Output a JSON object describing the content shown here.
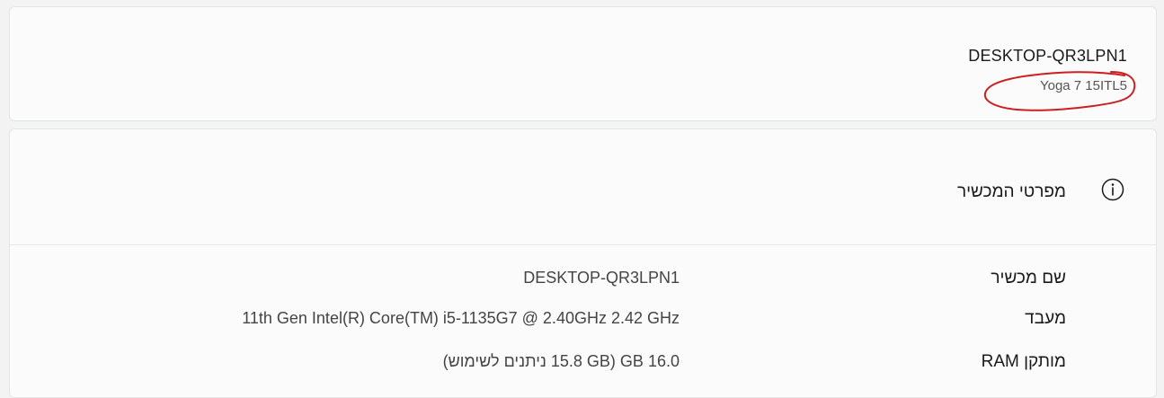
{
  "device": {
    "name": "DESKTOP-QR3LPN1",
    "model": "Yoga 7 15ITL5"
  },
  "specs": {
    "title": "מפרטי המכשיר",
    "icon": "info-icon",
    "rows": [
      {
        "label": "שם מכשיר",
        "value": "DESKTOP-QR3LPN1"
      },
      {
        "label": "מעבד",
        "value": "11th Gen Intel(R) Core(TM) i5-1135G7 @ 2.40GHz   2.42 GHz"
      },
      {
        "label": "מותקן RAM",
        "value": "16.0 GB (15.8 GB ניתנים לשימוש)"
      }
    ]
  },
  "colors": {
    "annotation": "#cc1f1f",
    "background": "#f3f3f3",
    "card": "#fbfbfb"
  }
}
